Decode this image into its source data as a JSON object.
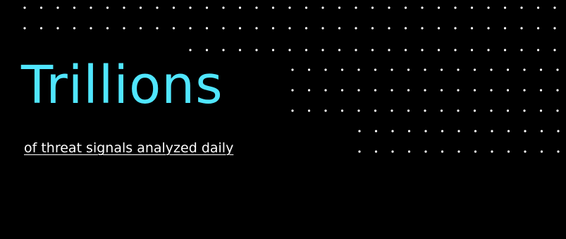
{
  "stat": {
    "value": "Trillions",
    "caption": "of threat signals analyzed daily"
  },
  "colors": {
    "background": "#000000",
    "accent": "#50e6ff",
    "caption": "#ffffff",
    "dots": "#ffffff"
  }
}
